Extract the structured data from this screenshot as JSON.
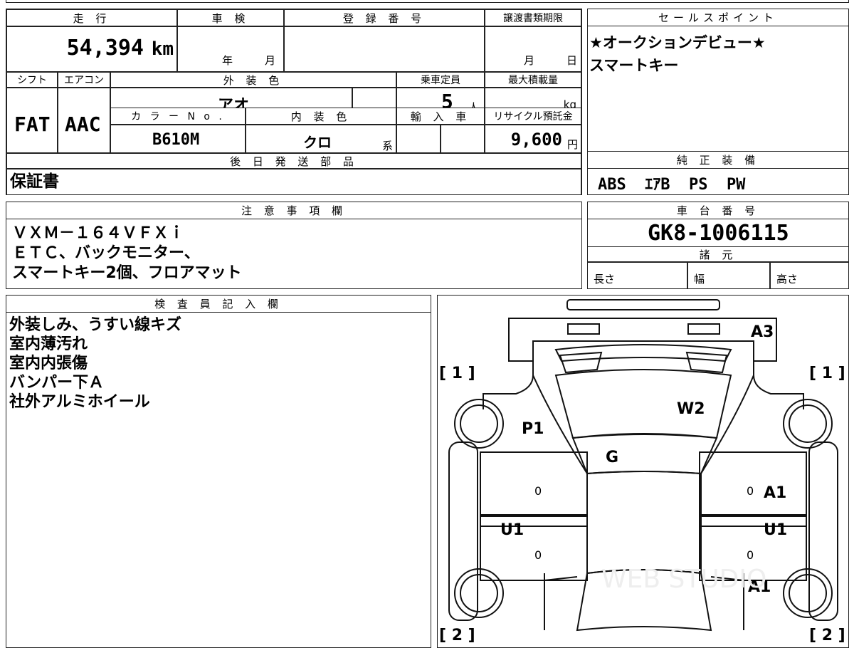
{
  "top_table": {
    "mileage": {
      "label": "走 行",
      "value": "54,394",
      "unit": "km"
    },
    "inspection": {
      "label": "車 検",
      "year": "年",
      "month": "月"
    },
    "registration": {
      "label": "登 録 番 号",
      "value": ""
    },
    "transfer_deadline": {
      "label": "譲渡書類期限",
      "month": "月",
      "day": "日"
    },
    "shift": {
      "label": "シフト",
      "value": "FAT"
    },
    "aircon": {
      "label": "エアコン",
      "value": "AAC"
    },
    "exterior_color": {
      "label": "外 装 色",
      "value": "アオ"
    },
    "capacity": {
      "label": "乗車定員",
      "value": "5",
      "unit": "人"
    },
    "max_load": {
      "label": "最大積載量",
      "unit": "kg"
    },
    "color_no": {
      "label": "カ ラ ー N o .",
      "value": "B610M"
    },
    "interior_color": {
      "label": "内 装 色",
      "value": "クロ",
      "unit": "系"
    },
    "import": {
      "label": "輸 入 車"
    },
    "recycle": {
      "label": "リサイクル預託金",
      "value": "9,600",
      "unit": "円"
    },
    "later_parts": {
      "label": "後 日 発 送 部 品",
      "value": "保証書"
    }
  },
  "sales_points": {
    "label": "セールスポイント",
    "lines": [
      "★オークションデビュー★",
      "スマートキー"
    ]
  },
  "genuine_equipment": {
    "label": "純 正 装 備",
    "value": "ABS  ｴｱB  PS  PW"
  },
  "notes": {
    "label": "注 意 事 項 欄",
    "lines": [
      "ＶＸＭ－１６４ＶＦＸｉ",
      "ＥＴＣ、バックモニター、",
      "スマートキー2個、フロアマット"
    ]
  },
  "chassis": {
    "label": "車 台 番 号",
    "value": "GK8-1006115"
  },
  "specs": {
    "label": "諸 元",
    "length": "長さ",
    "width": "幅",
    "height": "高さ"
  },
  "inspector": {
    "label": "検 査 員 記 入 欄",
    "lines": [
      "外装しみ、うすい線キズ",
      "室内薄汚れ",
      "室内内張傷",
      "バンパー下Ａ",
      "社外アルミホイール"
    ]
  },
  "diagram": {
    "marks": [
      "A3",
      "W2",
      "P1",
      "G",
      "A1",
      "U1",
      "U1",
      "A1"
    ],
    "wheel_labels": [
      "[ 1 ]",
      "[ 1 ]",
      "[ 2 ]",
      "[ 2 ]"
    ],
    "zeros": [
      "0",
      "0",
      "0",
      "0"
    ],
    "watermark": "WEB STUDIO"
  }
}
